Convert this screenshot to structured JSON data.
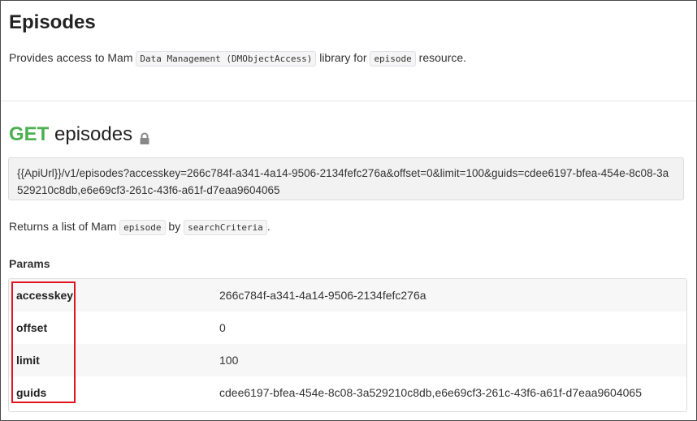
{
  "header": {
    "title": "Episodes",
    "desc_pre": "Provides access to Mam ",
    "desc_code1": "Data Management (DMObjectAccess)",
    "desc_mid": " library for ",
    "desc_code2": "episode",
    "desc_post": " resource."
  },
  "endpoint": {
    "method": "GET",
    "name": "episodes",
    "url": "{{ApiUrl}}/v1/episodes?accesskey=266c784f-a341-4a14-9506-2134fefc276a&offset=0&limit=100&guids=cdee6197-bfea-454e-8c08-3a529210c8db,e6e69cf3-261c-43f6-a61f-d7eaa9604065",
    "returns_pre": "Returns a list of Mam ",
    "returns_code1": "episode",
    "returns_mid": " by ",
    "returns_code2": "searchCriteria",
    "returns_post": "."
  },
  "params": {
    "heading": "Params",
    "rows": [
      {
        "key": "accesskey",
        "value": "266c784f-a341-4a14-9506-2134fefc276a"
      },
      {
        "key": "offset",
        "value": "0"
      },
      {
        "key": "limit",
        "value": "100"
      },
      {
        "key": "guids",
        "value": "cdee6197-bfea-454e-8c08-3a529210c8db,e6e69cf3-261c-43f6-a61f-d7eaa9604065"
      }
    ]
  },
  "icons": {
    "lock": "lock-icon"
  },
  "colors": {
    "method": "#4caf50",
    "highlight": "#e0141e"
  }
}
